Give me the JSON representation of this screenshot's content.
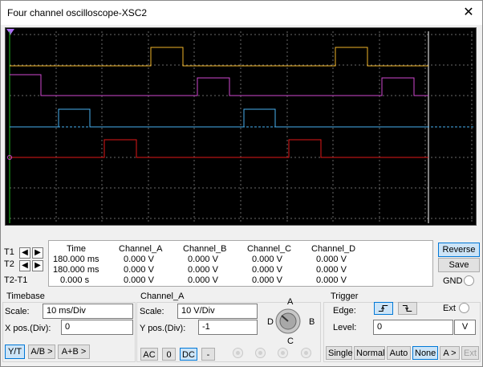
{
  "window": {
    "title": "Four channel oscilloscope-XSC2",
    "close_glyph": "✕"
  },
  "traces": {
    "A": {
      "color": "#f0b429"
    },
    "B": {
      "color": "#d048d0"
    },
    "C": {
      "color": "#48b0f0"
    },
    "D": {
      "color": "#e01818"
    }
  },
  "cursors": {
    "t1_label": "T1",
    "t2_label": "T2",
    "t2t1_label": "T2-T1",
    "left_glyph": "◀",
    "right_glyph": "▶"
  },
  "readout": {
    "headers": [
      "Time",
      "Channel_A",
      "Channel_B",
      "Channel_C",
      "Channel_D"
    ],
    "rows": [
      [
        "180.000 ms",
        "0.000 V",
        "0.000 V",
        "0.000 V",
        "0.000 V"
      ],
      [
        "180.000 ms",
        "0.000 V",
        "0.000 V",
        "0.000 V",
        "0.000 V"
      ],
      [
        "0.000 s",
        "0.000 V",
        "0.000 V",
        "0.000 V",
        "0.000 V"
      ]
    ]
  },
  "side_buttons": {
    "reverse": "Reverse",
    "save": "Save",
    "gnd": "GND"
  },
  "timebase": {
    "title": "Timebase",
    "scale_label": "Scale:",
    "scale_value": "10 ms/Div",
    "xpos_label": "X pos.(Div):",
    "xpos_value": "0",
    "modes": [
      "Y/T",
      "A/B >",
      "A+B >"
    ]
  },
  "channel": {
    "title": "Channel_A",
    "scale_label": "Scale:",
    "scale_value": "10  V/Div",
    "ypos_label": "Y pos.(Div):",
    "ypos_value": "-1",
    "coupling": [
      "AC",
      "0",
      "DC",
      "-"
    ],
    "knob": {
      "A": "A",
      "B": "B",
      "C": "C",
      "D": "D"
    }
  },
  "trigger": {
    "title": "Trigger",
    "edge_label": "Edge:",
    "ext_label": "Ext",
    "level_label": "Level:",
    "level_value": "0",
    "level_unit": "V",
    "modes": [
      "Single",
      "Normal",
      "Auto",
      "None",
      "A >",
      "Ext"
    ]
  }
}
